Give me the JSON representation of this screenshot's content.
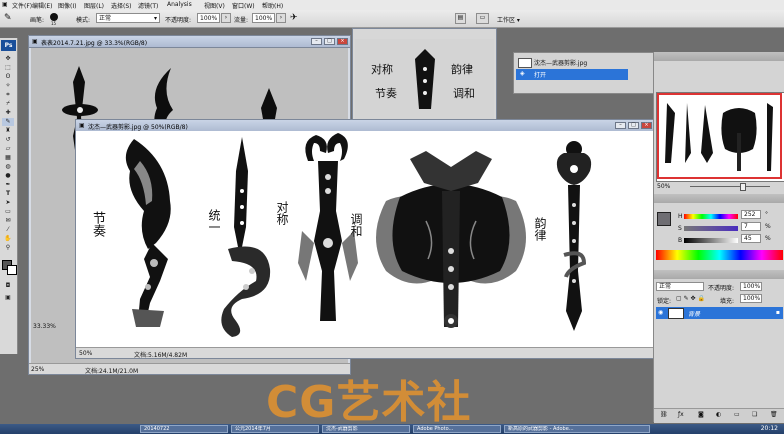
{
  "menu": [
    "文件(F)",
    "编辑(E)",
    "图像(I)",
    "图层(L)",
    "选择(S)",
    "滤镜(T)",
    "Analysis",
    "视图(V)",
    "窗口(W)",
    "帮助(H)"
  ],
  "options": {
    "brush_label": "画笔:",
    "brush_size": "15",
    "mode_label": "模式:",
    "mode_value": "正常",
    "opacity_label": "不透明度:",
    "opacity_value": "100%",
    "flow_label": "流量:",
    "flow_value": "100%",
    "workspace_label": "工作区 ▾"
  },
  "doc_back": {
    "title": "表表2014.7.21.jpg @ 33.3%(RGB/8)",
    "zoom": "33.33%",
    "status_zoom": "25%",
    "status_info": "文档:24.1M/21.0M"
  },
  "doc_front": {
    "title": "沈杰—武器剪影.jpg @ 50%(RGB/8)",
    "zoom": "50%",
    "status_info": "文档:5.16M/4.82M",
    "labels": [
      "节奏",
      "统一",
      "对称",
      "调和",
      "韵律"
    ]
  },
  "doc_small_labels": [
    "对称",
    "节奏",
    "韵律",
    "调和"
  ],
  "history": {
    "items": [
      "沈杰—武器剪影.jpg",
      "打开"
    ]
  },
  "color": {
    "h_label": "H",
    "h_value": "252",
    "s_label": "S",
    "s_value": "7",
    "b_label": "B",
    "b_value": "45",
    "unit": "%",
    "deg": "°"
  },
  "navigator": {
    "zoom": "50%"
  },
  "layers": {
    "blend": "正常",
    "opacity_label": "不透明度:",
    "opacity_value": "100%",
    "lock_label": "锁定:",
    "fill_label": "填充:",
    "fill_value": "100%",
    "layer_name": "背景"
  },
  "taskbar": [
    "20140722",
    "公元2014年7月",
    "沈杰-武器剪影",
    "Adobe Photo...",
    "新高原的武器剪影 - Adobe..."
  ],
  "clock": "20:12",
  "watermark": "CG艺术社"
}
